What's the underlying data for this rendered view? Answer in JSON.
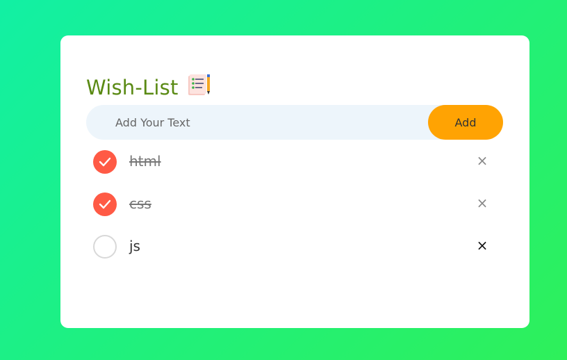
{
  "app": {
    "title": "Wish-List",
    "title_icon": "notepad-pencil-icon"
  },
  "input": {
    "placeholder": "Add Your Text",
    "value": "",
    "add_label": "Add"
  },
  "tasks": [
    {
      "text": "html",
      "completed": true,
      "remove_symbol": "×"
    },
    {
      "text": "css",
      "completed": true,
      "remove_symbol": "×"
    },
    {
      "text": "js",
      "completed": false,
      "remove_symbol": "×"
    }
  ],
  "colors": {
    "background_start": "#12f0a4",
    "background_end": "#2ef05a",
    "title": "#5a8a14",
    "add_button": "#ffa303",
    "checked": "#ff5a45",
    "input_background": "#edf5fb"
  }
}
